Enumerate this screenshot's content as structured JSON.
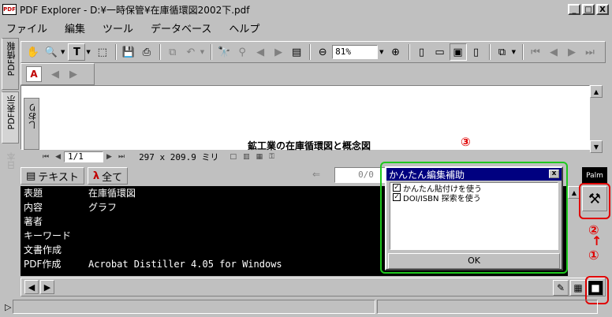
{
  "window": {
    "title": "PDF Explorer - D:¥一時保管¥在庫循環図2002下.pdf",
    "app_icon_label": "PDF",
    "minimize": "_",
    "maximize": "□",
    "close": "X"
  },
  "menu": [
    "ファイル",
    "編集",
    "ツール",
    "データベース",
    "ヘルプ"
  ],
  "left_tabs": [
    "PDF情報",
    "PDF表示",
    "日本"
  ],
  "toolbar": {
    "zoom_value": "81%",
    "zoom_out": "⊖",
    "zoom_in": "⊕"
  },
  "bookmark_tab": "しおり",
  "document": {
    "visible_text": "鉱工業の在庫循環図と概念図"
  },
  "page_nav": {
    "page_value": "1/1",
    "dimensions": "297 x 209.9 ミリ"
  },
  "info_tabs": {
    "text_tab": "テキスト",
    "all_tab": "全て"
  },
  "counter": "0/0",
  "info_rows": [
    {
      "key": "表題",
      "value": "在庫循環図"
    },
    {
      "key": "内容",
      "value": "グラフ"
    },
    {
      "key": "著者",
      "value": ""
    },
    {
      "key": "キーワード",
      "value": ""
    },
    {
      "key": "文書作成",
      "value": ""
    },
    {
      "key": "PDF作成",
      "value": "Acrobat Distiller 4.05 for Windows"
    }
  ],
  "dialog": {
    "title": "かんたん編集補助",
    "close": "x",
    "options": [
      {
        "label": "かんたん貼付けを使う",
        "checked": true
      },
      {
        "label": "DOI/ISBN 探索を使う",
        "checked": true
      }
    ],
    "ok": "OK"
  },
  "palm_label": "Palm",
  "annotations": {
    "circle1": "①",
    "circle2": "②",
    "circle3": "③",
    "arrow": "↑"
  },
  "colors": {
    "highlight_red": "#e00000",
    "highlight_green": "#1ec81e",
    "dialog_title_bg": "#000080"
  }
}
